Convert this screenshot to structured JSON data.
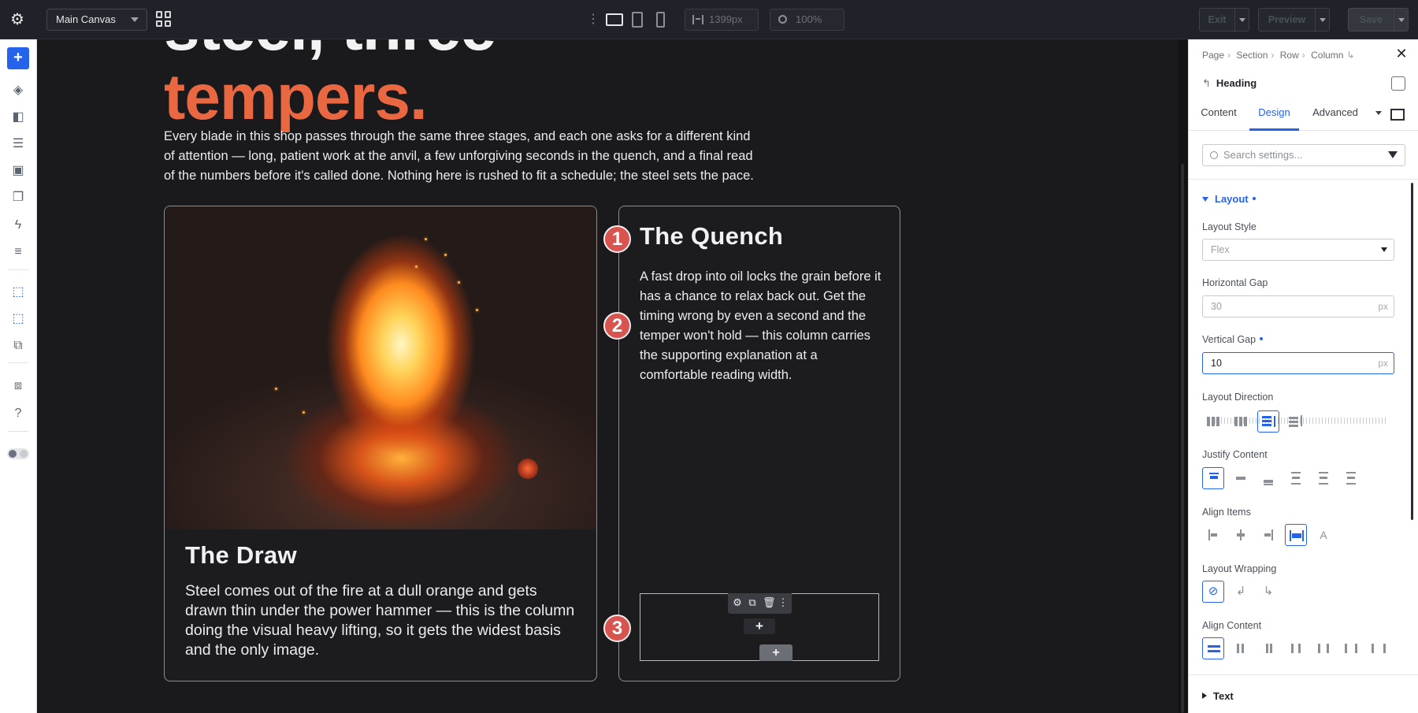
{
  "topbar": {
    "canvas_select": "Main Canvas",
    "width_value": "1399px",
    "zoom_value": "100%",
    "exit_label": "Exit",
    "preview_label": "Preview",
    "save_label": "Save"
  },
  "canvas": {
    "headline_top": "steel, three",
    "headline_word": "tempers.",
    "lead": "Every blade in this shop passes through the same three stages, and each one asks for a different kind of attention — long, patient work at the anvil, a few unforgiving seconds in the quench, and a final read of the numbers before it's called done. Nothing here is rushed to fit a schedule; the steel sets the pace.",
    "card_draw": {
      "title": "The Draw",
      "body": "Steel comes out of the fire at a dull orange and gets drawn thin under the power hammer — this is the column doing the visual heavy lifting, so it gets the widest basis and the only image."
    },
    "card_quench": {
      "title": "The Quench",
      "body": "A fast drop into oil locks the grain before it has a chance to relax back out. Get the timing wrong by even a second and the temper won't hold — this column carries the supporting explanation at a comfortable reading width."
    },
    "markers": [
      "1",
      "2",
      "3"
    ],
    "dropzone_add": "+",
    "dropzone_add2": "+"
  },
  "panel": {
    "breadcrumbs": [
      "Page",
      "Section",
      "Row",
      "Column"
    ],
    "element": "Heading",
    "tabs": [
      "Content",
      "Design",
      "Advanced"
    ],
    "active_tab": "Design",
    "search_placeholder": "Search settings...",
    "group": "Layout",
    "layout_style_label": "Layout Style",
    "layout_style_value": "Flex",
    "horizontal_gap_label": "Horizontal Gap",
    "horizontal_gap_value": "30",
    "horizontal_gap_unit": "px",
    "vertical_gap_label": "Vertical Gap",
    "vertical_gap_value": "10",
    "vertical_gap_unit": "px",
    "layout_direction_label": "Layout Direction",
    "justify_content_label": "Justify Content",
    "align_items_label": "Align Items",
    "layout_wrapping_label": "Layout Wrapping",
    "align_content_label": "Align Content",
    "text_group": "Text"
  },
  "colors": {
    "accent": "#2563eb",
    "headline_orange": "#e96842",
    "marker_red": "#d9534f",
    "canvas_bg": "#1a1a1d"
  }
}
